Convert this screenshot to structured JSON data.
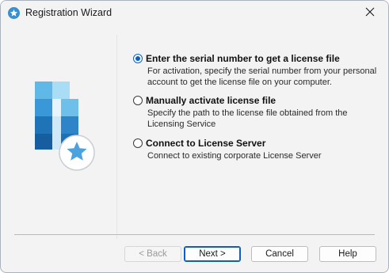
{
  "window": {
    "title": "Registration Wizard"
  },
  "options": [
    {
      "label": "Enter the serial number to get a license file",
      "description": "For activation, specify the serial number from your personal account to get the license file on your computer.",
      "selected": true
    },
    {
      "label": "Manually activate license file",
      "description": "Specify the path to the license file obtained from the Licensing Service",
      "selected": false
    },
    {
      "label": "Connect to License Server",
      "description": "Connect to existing corporate License Server",
      "selected": false
    }
  ],
  "buttons": {
    "back": "< Back",
    "next": "Next >",
    "cancel": "Cancel",
    "help": "Help"
  },
  "colors": {
    "accent": "#0a5fc4",
    "logo_dark": "#1f73b7",
    "logo_light": "#5fb8e6",
    "star": "#4aa3df"
  },
  "icons": {
    "app": "star-badge-icon",
    "close": "close-icon",
    "illustration": "license-star-logo"
  }
}
